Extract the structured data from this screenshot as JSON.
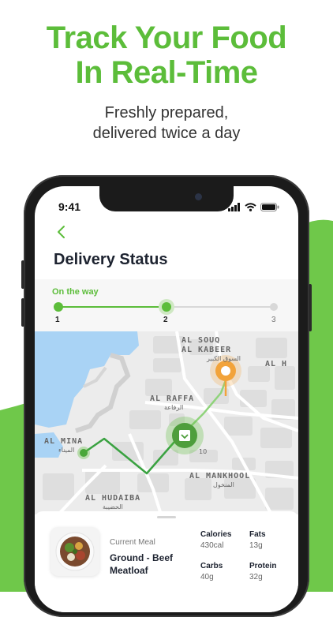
{
  "promo": {
    "headline_line1": "Track Your Food",
    "headline_line2": "In Real-Time",
    "subline_line1": "Freshly prepared,",
    "subline_line2": "delivered twice a day"
  },
  "status_bar": {
    "time": "9:41",
    "icons": [
      "signal-icon",
      "wifi-icon",
      "battery-icon"
    ]
  },
  "screen": {
    "back_icon": "chevron-left-icon",
    "title": "Delivery Status",
    "stage_label": "On the way",
    "steps": [
      {
        "number": "1",
        "state": "done"
      },
      {
        "number": "2",
        "state": "current"
      },
      {
        "number": "3",
        "state": "pending"
      }
    ],
    "current_step": 2
  },
  "map": {
    "areas": [
      {
        "name": "AL SOUQ"
      },
      {
        "name": "AL KABEER",
        "arabic": "السوق الكبير"
      },
      {
        "name": "AL H"
      },
      {
        "name": "AL RAFFA",
        "arabic": "الرفاعة"
      },
      {
        "name": "AL MINA",
        "arabic": "الميناء"
      },
      {
        "name": "AL MANKHOOL",
        "arabic": "المنخول"
      },
      {
        "name": "AL HUDAIBA",
        "arabic": "الحضيبة"
      }
    ],
    "route_label": "10"
  },
  "meal": {
    "caption": "Current Meal",
    "name_line1": "Ground - Beef",
    "name_line2": "Meatloaf",
    "nutrition": [
      {
        "label": "Calories",
        "value": "430cal"
      },
      {
        "label": "Fats",
        "value": "13g"
      },
      {
        "label": "Carbs",
        "value": "40g"
      },
      {
        "label": "Protein",
        "value": "32g"
      }
    ]
  },
  "colors": {
    "brand_green": "#5cbd3a",
    "courier_green": "#5cbd3a",
    "destination_orange": "#f2a33a",
    "water": "#a9d3f5"
  }
}
